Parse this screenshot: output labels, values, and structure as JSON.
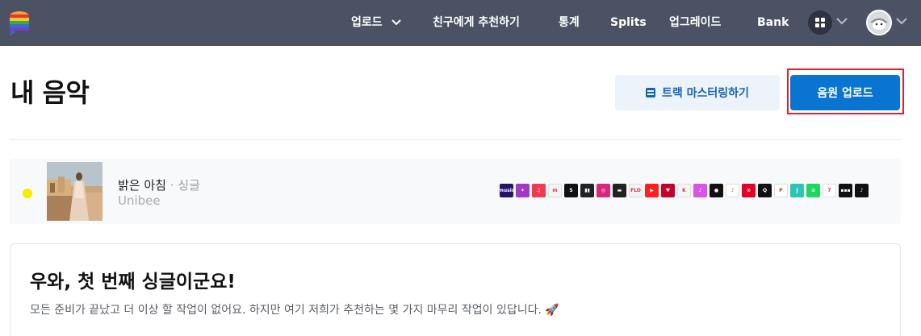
{
  "nav": {
    "upload": "업로드",
    "recommend": "친구에게 추천하기",
    "stats": "통계",
    "splits": "Splits",
    "upgrade": "업그레이드",
    "bank": "Bank"
  },
  "page": {
    "title": "내 음악"
  },
  "actions": {
    "master_label": "트랙 마스터링하기",
    "upload_label": "음원 업로드"
  },
  "release": {
    "title": "밝은 아침",
    "type": "· 싱글",
    "artist": "Unibee",
    "status_color": "#f8ec00",
    "stores": [
      {
        "icon": "amazon-music-icon",
        "bg": "#25126b",
        "text": "music"
      },
      {
        "icon": "anghami-icon",
        "bg": "#a238c9",
        "text": "✦"
      },
      {
        "icon": "apple-music-icon",
        "bg": "#f0384f",
        "text": "♫"
      },
      {
        "icon": "melon-icon",
        "bg": "#f4f4f4",
        "text": "m"
      },
      {
        "icon": "shazam-icon",
        "bg": "#111111",
        "text": "S"
      },
      {
        "icon": "deezer-icon",
        "bg": "#222222",
        "text": "▮▮"
      },
      {
        "icon": "instagram-icon",
        "bg": "#d6297a",
        "text": "◎"
      },
      {
        "icon": "genie-icon",
        "bg": "#222222",
        "text": "▬"
      },
      {
        "icon": "flo-icon",
        "bg": "#f0f2f5",
        "text": "FLO"
      },
      {
        "icon": "youtube-music-icon",
        "bg": "#ff1f1f",
        "text": "▶"
      },
      {
        "icon": "iheart-icon",
        "bg": "#c6002b",
        "text": "♥"
      },
      {
        "icon": "kkbox-icon",
        "bg": "#f6f6f6",
        "text": "K"
      },
      {
        "icon": "itunes-icon",
        "bg": "#d455e6",
        "text": "♪"
      },
      {
        "icon": "audiomack-icon",
        "bg": "#111111",
        "text": "●"
      },
      {
        "icon": "qq-music-icon",
        "bg": "#ffffff",
        "text": "♪"
      },
      {
        "icon": "netease-icon",
        "bg": "#e60026",
        "text": "⊙"
      },
      {
        "icon": "qobuz-icon",
        "bg": "#111111",
        "text": "Q"
      },
      {
        "icon": "pandora-icon",
        "bg": "#ffffff",
        "text": "P"
      },
      {
        "icon": "jiosaavn-icon",
        "bg": "#2bc5b4",
        "text": "J"
      },
      {
        "icon": "spotify-icon",
        "bg": "#1ed760",
        "text": "≋"
      },
      {
        "icon": "tidal-icon",
        "bg": "#ffffff",
        "text": "7"
      },
      {
        "icon": "napster-icon",
        "bg": "#111111",
        "text": "▪▪▪"
      },
      {
        "icon": "tiktok-icon",
        "bg": "#111111",
        "text": "♪"
      }
    ]
  },
  "card": {
    "title": "우와, 첫 번째 싱글이군요!",
    "text": "모든 준비가 끝났고 더 이상 할 작업이 없어요. 하지만 여기 저희가 추천하는 몇 가지 마무리 작업이 있답니다. 🚀"
  }
}
